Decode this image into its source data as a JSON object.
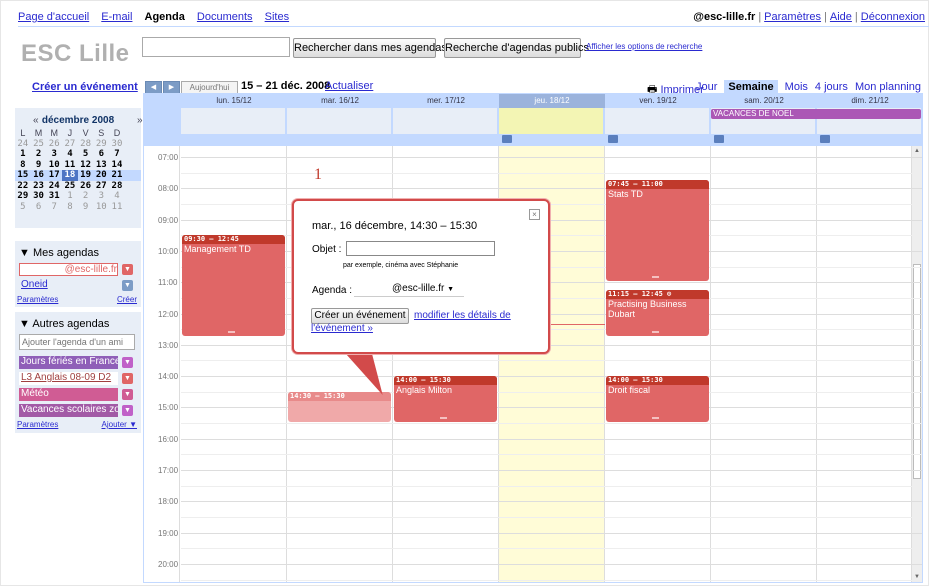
{
  "topnav": {
    "home": "Page d'accueil",
    "email": "E-mail",
    "agenda": "Agenda",
    "documents": "Documents",
    "sites": "Sites"
  },
  "topright": {
    "user": "@esc-lille.fr",
    "settings": "Paramètres",
    "help": "Aide",
    "logout": "Déconnexion"
  },
  "logo": "ESC Lille",
  "search": {
    "placeholder": "",
    "btn_mine": "Rechercher dans mes agendas",
    "btn_public": "Recherche d'agendas publics",
    "options": "Afficher les options de recherche"
  },
  "sidebar": {
    "create": "Créer un événement",
    "minical": {
      "title": "décembre 2008",
      "prev": "«",
      "next": "»",
      "dow": [
        "L",
        "M",
        "M",
        "J",
        "V",
        "S",
        "D"
      ],
      "weeks": [
        [
          "24",
          "25",
          "26",
          "27",
          "28",
          "29",
          "30"
        ],
        [
          "1",
          "2",
          "3",
          "4",
          "5",
          "6",
          "7"
        ],
        [
          "8",
          "9",
          "10",
          "11",
          "12",
          "13",
          "14"
        ],
        [
          "15",
          "16",
          "17",
          "18",
          "19",
          "20",
          "21"
        ],
        [
          "22",
          "23",
          "24",
          "25",
          "26",
          "27",
          "28"
        ],
        [
          "29",
          "30",
          "31",
          "1",
          "2",
          "3",
          "4"
        ],
        [
          "5",
          "6",
          "7",
          "8",
          "9",
          "10",
          "11"
        ]
      ]
    },
    "my_agendas": {
      "title": "▼ Mes agendas",
      "items": [
        {
          "label": "@esc-lille.fr"
        },
        {
          "label": "Oneid"
        }
      ],
      "settings": "Paramètres",
      "create": "Créer"
    },
    "other_agendas": {
      "title": "▼ Autres agendas",
      "placeholder": "Ajouter l'agenda d'un ami",
      "items": [
        {
          "label": "Jours fériés en France",
          "color": "#8f5fb8"
        },
        {
          "label": "L3 Anglais 08-09 D2",
          "color": "#ffffff"
        },
        {
          "label": "Météo",
          "color": "#d05c94"
        },
        {
          "label": "Vacances scolaires zone",
          "color": "#a25aa6"
        }
      ],
      "settings": "Paramètres",
      "add": "Ajouter ▼"
    }
  },
  "toolbar": {
    "prev": "◀",
    "next": "▶",
    "today": "Aujourd'hui",
    "range": "15 – 21 déc. 2008",
    "refresh": "Actualiser",
    "print": "Imprimer",
    "views": [
      "Jour",
      "Semaine",
      "Mois",
      "4 jours",
      "Mon planning"
    ],
    "selected_view": "Semaine"
  },
  "days": [
    "lun. 15/12",
    "mar. 16/12",
    "mer. 17/12",
    "jeu. 18/12",
    "ven. 19/12",
    "sam. 20/12",
    "dim. 21/12"
  ],
  "allday": {
    "holiday": "VACANCES DE NOEL"
  },
  "hours": [
    "07:00",
    "08:00",
    "09:00",
    "10:00",
    "11:00",
    "12:00",
    "13:00",
    "14:00",
    "15:00",
    "16:00",
    "17:00",
    "18:00",
    "19:00",
    "20:00"
  ],
  "marker": "1",
  "events": [
    {
      "time": "09:30 – 12:45",
      "title": "Management TD"
    },
    {
      "time": "14:30 – 15:30",
      "title": ""
    },
    {
      "time": "14:00 – 15:30",
      "title": "Anglais Milton"
    },
    {
      "time": "07:45 – 11:00",
      "title": "Stats TD"
    },
    {
      "time": "11:15 – 12:45 ⊙",
      "title": "Practising Business Dubart"
    },
    {
      "time": "14:00 – 15:30",
      "title": "Droit fiscal"
    }
  ],
  "popup": {
    "when": "mar., 16 décembre, 14:30 – 15:30",
    "subject_label": "Objet :",
    "subject_value": "",
    "hint": "par exemple, cinéma avec Stéphanie",
    "agenda_label": "Agenda :",
    "agenda_value": "@esc-lille.fr",
    "create_btn": "Créer un événement",
    "edit_link": "modifier les détails de l'événement »",
    "close": "×"
  },
  "colors": {
    "accent": "#c3d9ff",
    "event": "#e06666",
    "event_head": "#c0392b",
    "holiday": "#ab57b5",
    "today": "#fffcd7"
  }
}
